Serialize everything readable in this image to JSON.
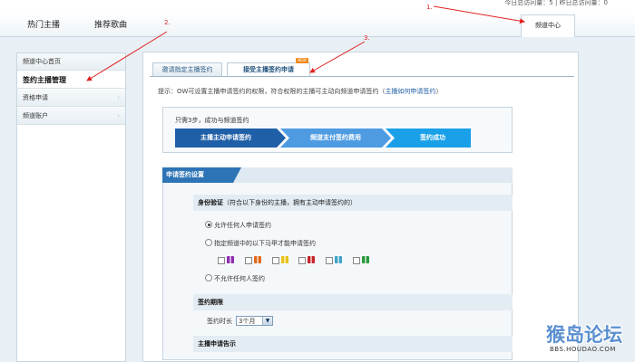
{
  "header": {
    "stats": "今日总访问量：5 | 昨日总访问量：0",
    "nav_tabs": [
      {
        "label": "热门主播"
      },
      {
        "label": "推荐歌曲"
      }
    ],
    "channel_center": "频道中心"
  },
  "sidebar": {
    "items": [
      {
        "label": "频道中心首页"
      },
      {
        "label": "签约主播管理"
      },
      {
        "label": "资格申请"
      },
      {
        "label": "频道账户"
      }
    ]
  },
  "subtabs": [
    {
      "label": "邀请指定主播签约"
    },
    {
      "label": "接受主播签约申请"
    }
  ],
  "new_badge": "NEW",
  "hint": {
    "prefix": "提示：OW可设置主播申请签约的权限，符合权限的主播可主动向频道申请签约（",
    "link": "主播如何申请签约",
    "suffix": "）"
  },
  "steps": {
    "title": "只需3步，成功与频道签约",
    "items": [
      {
        "label": "主播主动申请签约",
        "color": "#1f5fa7"
      },
      {
        "label": "频道支付签约费用",
        "color": "#4e9be2"
      },
      {
        "label": "签约成功",
        "color": "#1aa0e8"
      }
    ]
  },
  "form": {
    "header": "申请签约设置",
    "identity_title": "身份验证",
    "identity_note": "（符合以下身份的主播，拥有主动申请签约的）",
    "options": [
      {
        "label": "允许任何人申请签约",
        "selected": true
      },
      {
        "label": "指定频道中的以下马甲才能申请签约",
        "selected": false
      },
      {
        "label": "不允许任何人签约",
        "selected": false
      }
    ],
    "badges": [
      {
        "color": "#8e2bb0"
      },
      {
        "color": "#e26a1b"
      },
      {
        "color": "#e8c21a"
      },
      {
        "color": "#c4262a"
      },
      {
        "color": "#3fa1c6"
      },
      {
        "color": "#2a9a3a"
      }
    ],
    "term_title": "签约期限",
    "term_label": "签约时长",
    "term_value": "3个月",
    "notice_title": "主播申请告示"
  },
  "annotations": {
    "one": "1.",
    "two": "2.",
    "three": "3.",
    "arrow_color": "#e02020"
  },
  "watermark": {
    "main": "猴岛论坛",
    "sub": "BBS.HOUDAO.COM"
  }
}
